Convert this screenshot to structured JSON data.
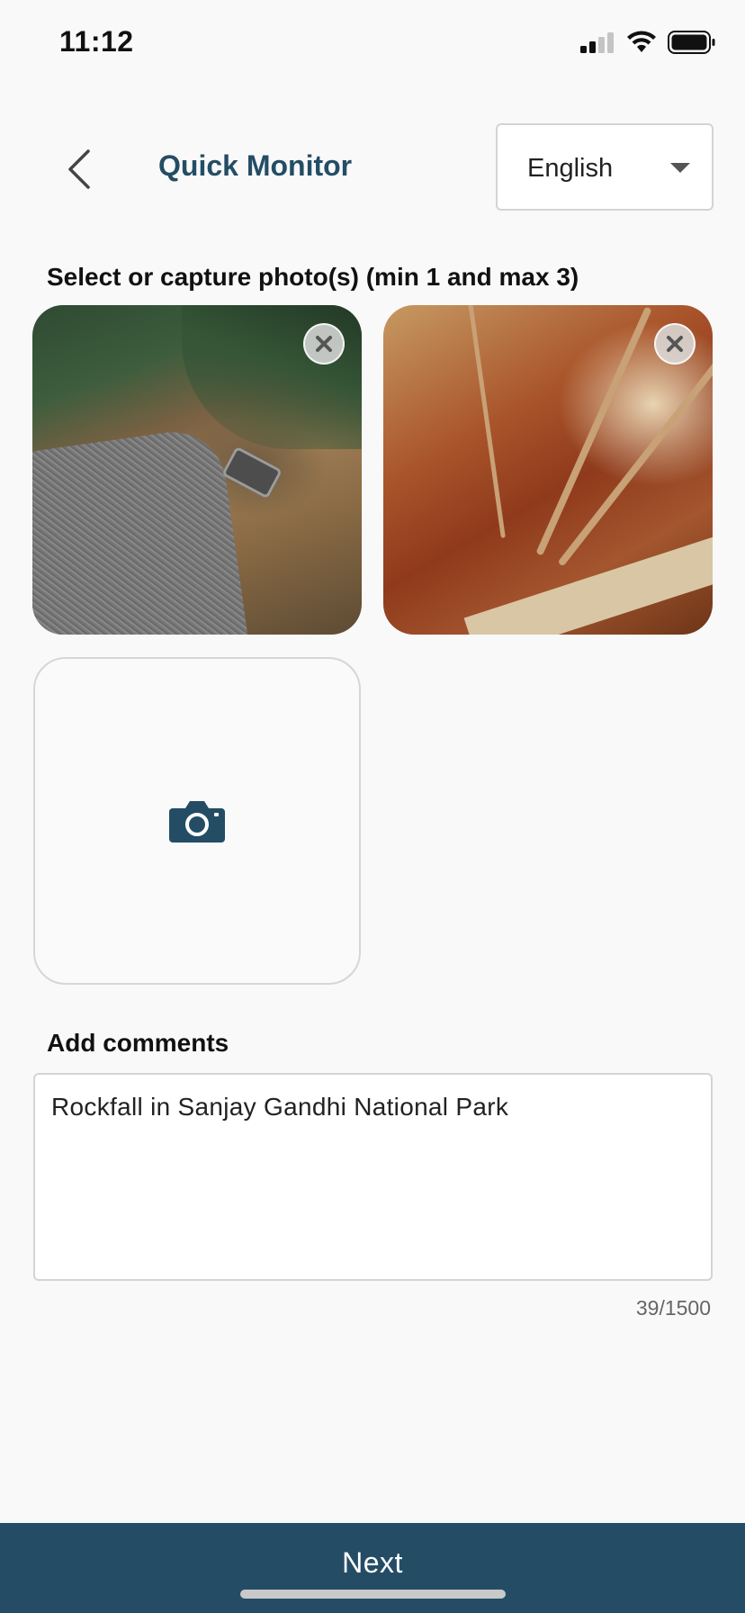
{
  "status_bar": {
    "time": "11:12",
    "icons": [
      "cellular-signal-icon",
      "wifi-icon",
      "battery-icon"
    ]
  },
  "header": {
    "back_icon": "chevron-left-icon",
    "title": "Quick Monitor",
    "language": {
      "selected": "English",
      "caret_icon": "caret-down-icon"
    }
  },
  "photos": {
    "label": "Select or capture photo(s) (min 1 and max 3)",
    "items": [
      {
        "description_icon": "landslide-road-photo",
        "remove_icon": "close-icon"
      },
      {
        "description_icon": "rockfall-slope-photo",
        "remove_icon": "close-icon"
      }
    ],
    "add_icon": "camera-icon"
  },
  "comments": {
    "label": "Add comments",
    "value": "Rockfall in Sanjay Gandhi National Park",
    "count": "39/1500"
  },
  "footer": {
    "next_label": "Next"
  },
  "colors": {
    "primary": "#244d65",
    "background": "#f9f9f9",
    "border": "#d4d4d4"
  }
}
